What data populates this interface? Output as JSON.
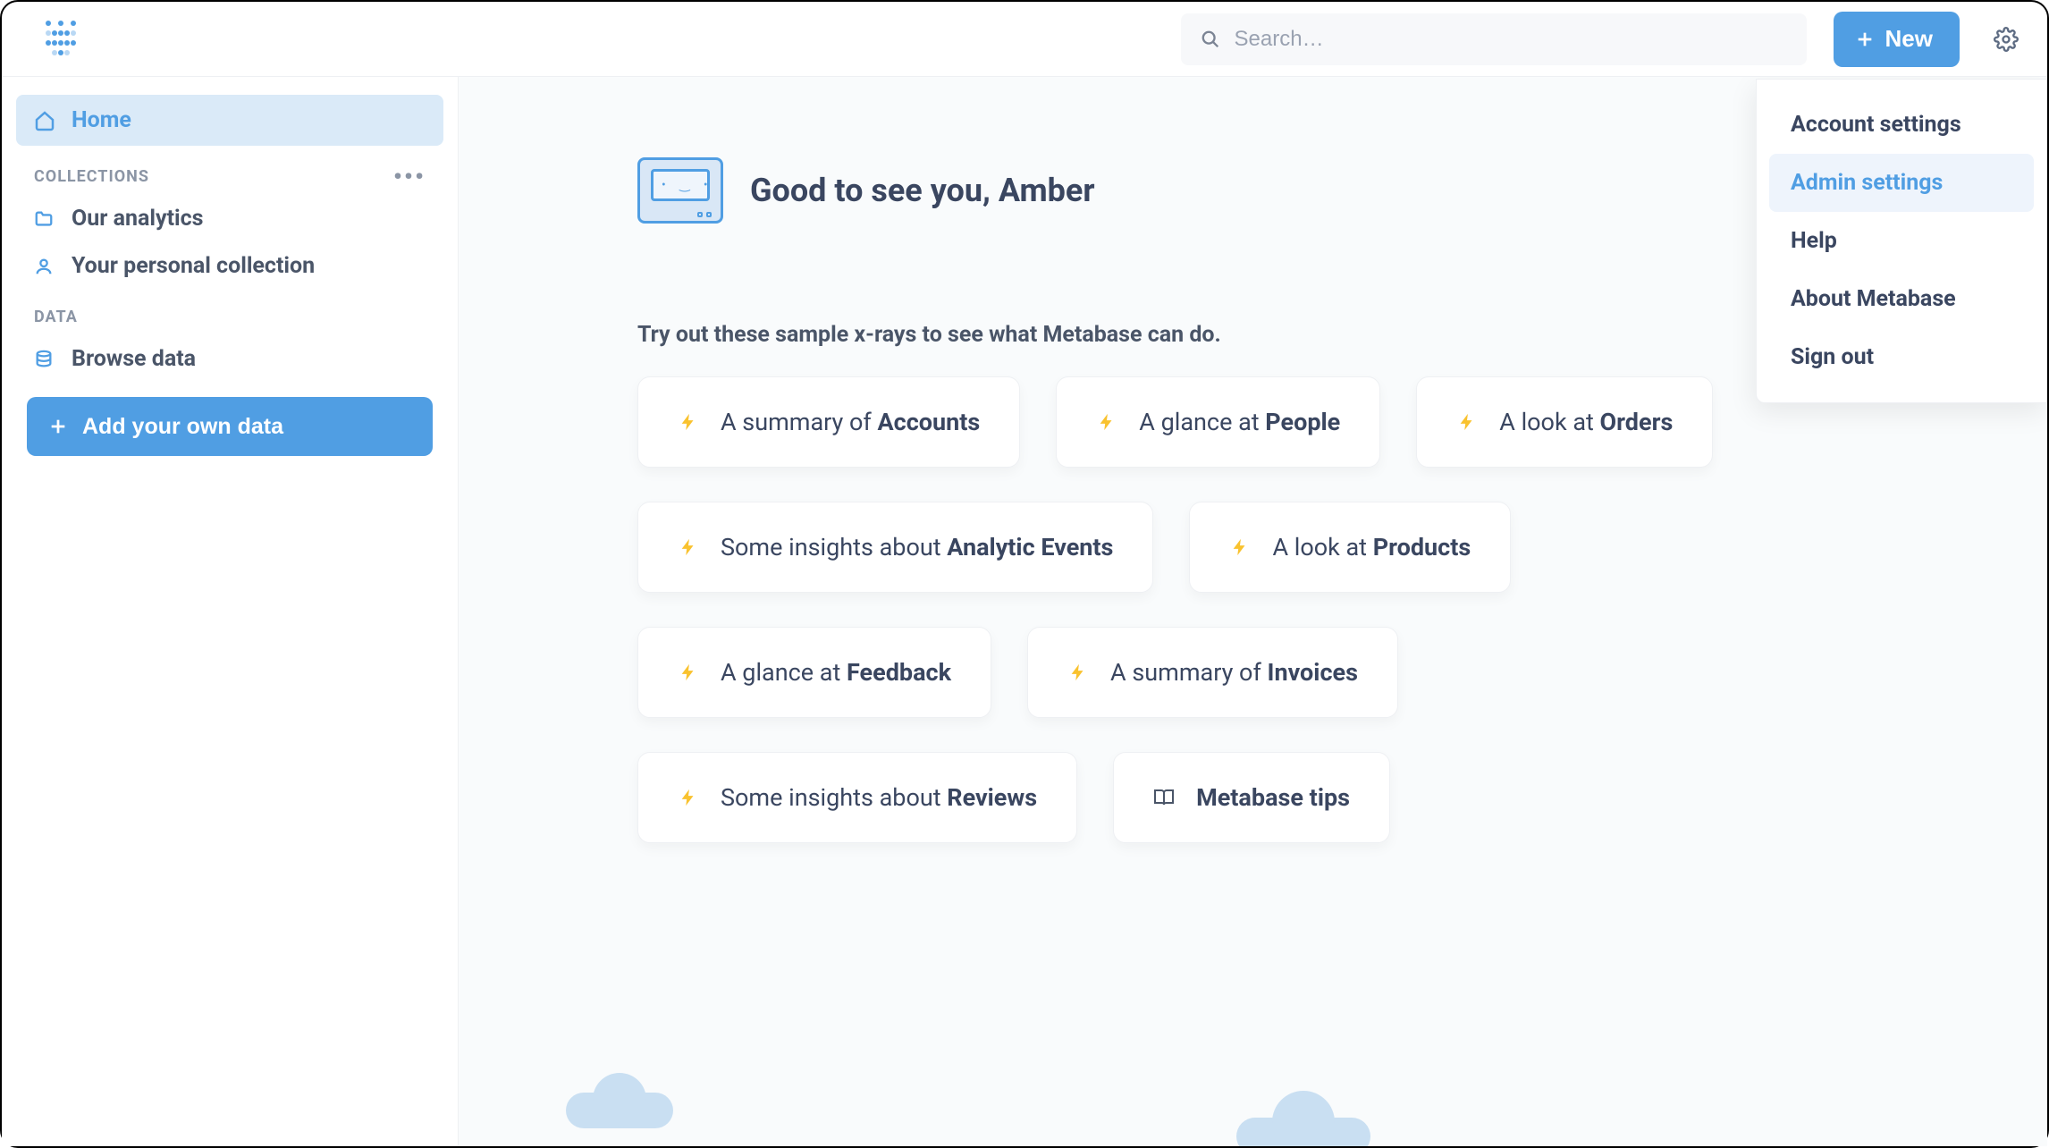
{
  "header": {
    "search_placeholder": "Search…",
    "new_label": "New"
  },
  "sidebar": {
    "home_label": "Home",
    "collections_header": "COLLECTIONS",
    "collections": [
      {
        "label": "Our analytics"
      },
      {
        "label": "Your personal collection"
      }
    ],
    "data_header": "DATA",
    "browse_label": "Browse data",
    "add_data_label": "Add your own data"
  },
  "main": {
    "greeting": "Good to see you, Amber",
    "xray_intro": "Try out these sample x-rays to see what Metabase can do.",
    "cards": [
      {
        "prefix": "A summary of ",
        "bold": "Accounts",
        "icon": "bolt"
      },
      {
        "prefix": "A glance at ",
        "bold": "People",
        "icon": "bolt"
      },
      {
        "prefix": "A look at ",
        "bold": "Orders",
        "icon": "bolt"
      },
      {
        "prefix": "Some insights about ",
        "bold": "Analytic Events",
        "icon": "bolt"
      },
      {
        "prefix": "A look at ",
        "bold": "Products",
        "icon": "bolt"
      },
      {
        "prefix": "A glance at ",
        "bold": "Feedback",
        "icon": "bolt"
      },
      {
        "prefix": "A summary of ",
        "bold": "Invoices",
        "icon": "bolt"
      },
      {
        "prefix": "Some insights about ",
        "bold": "Reviews",
        "icon": "bolt"
      },
      {
        "prefix": "",
        "bold": "Metabase tips",
        "icon": "book"
      }
    ]
  },
  "settings_menu": [
    {
      "label": "Account settings",
      "active": false
    },
    {
      "label": "Admin settings",
      "active": true
    },
    {
      "label": "Help",
      "active": false
    },
    {
      "label": "About Metabase",
      "active": false
    },
    {
      "label": "Sign out",
      "active": false
    }
  ]
}
